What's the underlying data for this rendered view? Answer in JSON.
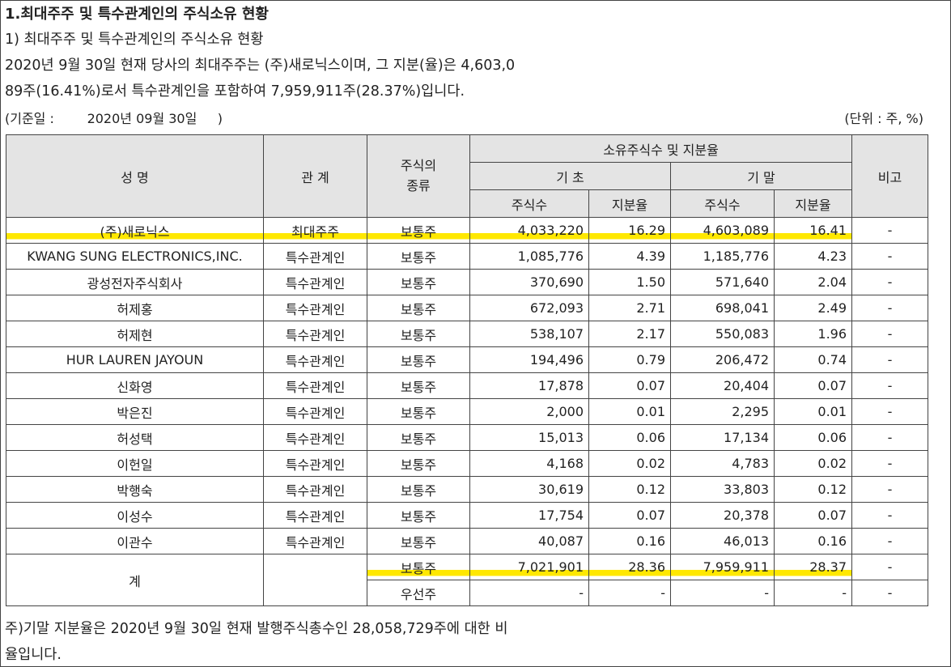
{
  "title": "1.최대주주 및 특수관계인의 주식소유 현황",
  "subtitle": "1) 최대주주 및 특수관계인의 주식소유 현황",
  "para1": "2020년 9월 30일 현재 당사의 최대주주는 (주)새로닉스이며, 그 지분(율)은 4,603,0",
  "para2": "89주(16.41%)로서 특수관계인을 포함하여 7,959,911주(28.37%)입니다.",
  "basis": "(기준일 :        2020년 09월 30일     )",
  "unit": "(단위 : 주, %)",
  "headers": {
    "name": "성 명",
    "relation": "관 계",
    "stock_type": "주식의\n종류",
    "holdings": "소유주식수 및 지분율",
    "begin": "기 초",
    "end": "기 말",
    "shares": "주식수",
    "ratio": "지분율",
    "note": "비고"
  },
  "rows": [
    {
      "name": "(주)새로닉스",
      "relation": "최대주주",
      "type": "보통주",
      "begin_shares": "4,033,220",
      "begin_ratio": "16.29",
      "end_shares": "4,603,089",
      "end_ratio": "16.41",
      "note": "-"
    },
    {
      "name": "KWANG SUNG ELECTRONICS,INC.",
      "relation": "특수관계인",
      "type": "보통주",
      "begin_shares": "1,085,776",
      "begin_ratio": "4.39",
      "end_shares": "1,185,776",
      "end_ratio": "4.23",
      "note": "-"
    },
    {
      "name": "광성전자주식회사",
      "relation": "특수관계인",
      "type": "보통주",
      "begin_shares": "370,690",
      "begin_ratio": "1.50",
      "end_shares": "571,640",
      "end_ratio": "2.04",
      "note": "-"
    },
    {
      "name": "허제홍",
      "relation": "특수관계인",
      "type": "보통주",
      "begin_shares": "672,093",
      "begin_ratio": "2.71",
      "end_shares": "698,041",
      "end_ratio": "2.49",
      "note": "-"
    },
    {
      "name": "허제현",
      "relation": "특수관계인",
      "type": "보통주",
      "begin_shares": "538,107",
      "begin_ratio": "2.17",
      "end_shares": "550,083",
      "end_ratio": "1.96",
      "note": "-"
    },
    {
      "name": "HUR LAUREN JAYOUN",
      "relation": "특수관계인",
      "type": "보통주",
      "begin_shares": "194,496",
      "begin_ratio": "0.79",
      "end_shares": "206,472",
      "end_ratio": "0.74",
      "note": "-"
    },
    {
      "name": "신화영",
      "relation": "특수관계인",
      "type": "보통주",
      "begin_shares": "17,878",
      "begin_ratio": "0.07",
      "end_shares": "20,404",
      "end_ratio": "0.07",
      "note": "-"
    },
    {
      "name": "박은진",
      "relation": "특수관계인",
      "type": "보통주",
      "begin_shares": "2,000",
      "begin_ratio": "0.01",
      "end_shares": "2,295",
      "end_ratio": "0.01",
      "note": "-"
    },
    {
      "name": "허성택",
      "relation": "특수관계인",
      "type": "보통주",
      "begin_shares": "15,013",
      "begin_ratio": "0.06",
      "end_shares": "17,134",
      "end_ratio": "0.06",
      "note": "-"
    },
    {
      "name": "이헌일",
      "relation": "특수관계인",
      "type": "보통주",
      "begin_shares": "4,168",
      "begin_ratio": "0.02",
      "end_shares": "4,783",
      "end_ratio": "0.02",
      "note": "-"
    },
    {
      "name": "박행숙",
      "relation": "특수관계인",
      "type": "보통주",
      "begin_shares": "30,619",
      "begin_ratio": "0.12",
      "end_shares": "33,803",
      "end_ratio": "0.12",
      "note": "-"
    },
    {
      "name": "이성수",
      "relation": "특수관계인",
      "type": "보통주",
      "begin_shares": "17,754",
      "begin_ratio": "0.07",
      "end_shares": "20,378",
      "end_ratio": "0.07",
      "note": "-"
    },
    {
      "name": "이관수",
      "relation": "특수관계인",
      "type": "보통주",
      "begin_shares": "40,087",
      "begin_ratio": "0.16",
      "end_shares": "46,013",
      "end_ratio": "0.16",
      "note": "-"
    }
  ],
  "total": {
    "label": "계",
    "common": {
      "type": "보통주",
      "begin_shares": "7,021,901",
      "begin_ratio": "28.36",
      "end_shares": "7,959,911",
      "end_ratio": "28.37",
      "note": "-"
    },
    "preferred": {
      "type": "우선주",
      "begin_shares": "-",
      "begin_ratio": "-",
      "end_shares": "-",
      "end_ratio": "-",
      "note": "-"
    }
  },
  "note1": "주)기말 지분율은 2020년 9월 30일 현재 발행주식총수인 28,058,729주에 대한 비",
  "note2": "율입니다.",
  "highlight_color": "#ffe800"
}
